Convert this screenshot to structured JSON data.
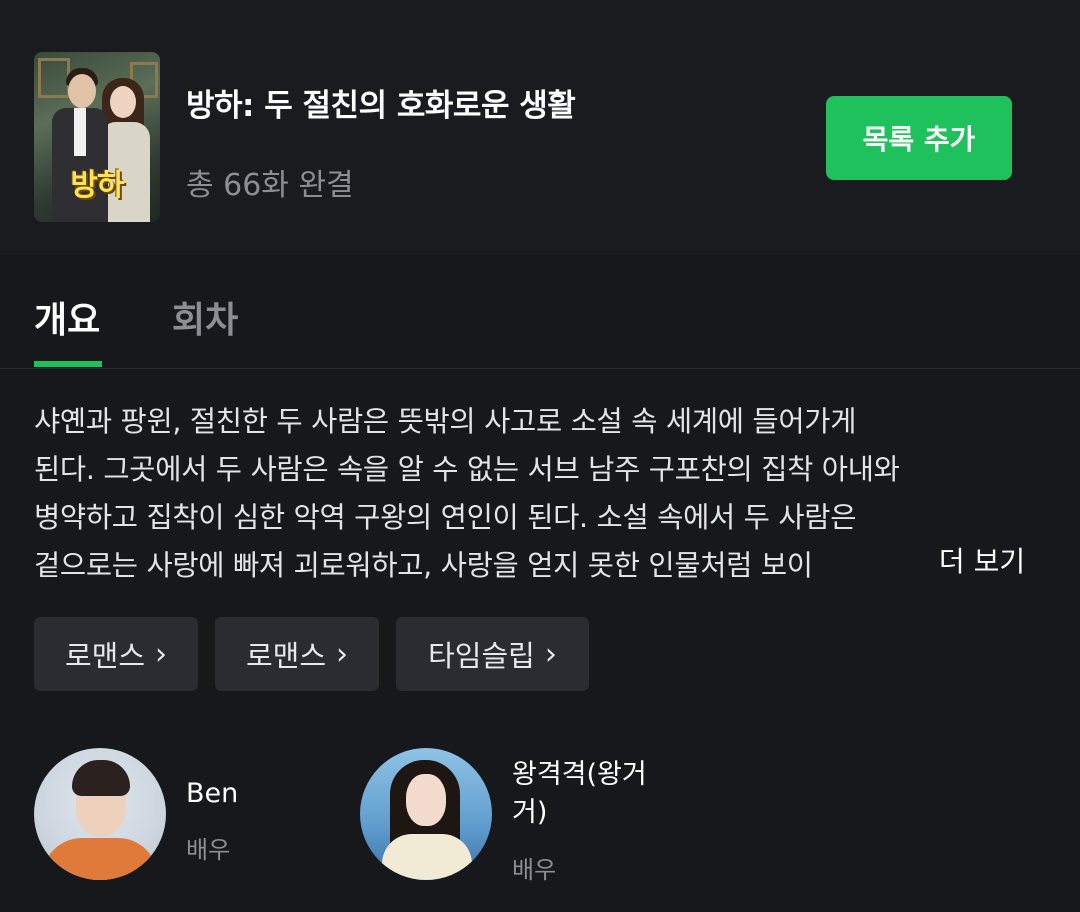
{
  "header": {
    "poster_title": "방하",
    "title": "방하: 두 절친의 호화로운 생활",
    "episodes": "총 66화 완결",
    "add_button": "목록 추가"
  },
  "tabs": [
    {
      "label": "개요",
      "active": true
    },
    {
      "label": "회차",
      "active": false
    }
  ],
  "synopsis": {
    "lines": [
      "샤옌과 팡윈, 절친한 두 사람은 뜻밖의 사고로 소설 속 세계에 들어가게",
      "된다. 그곳에서 두 사람은 속을 알 수 없는 서브 남주 구포찬의 집착 아내와",
      "병약하고 집착이 심한 악역 구왕의 연인이 된다. 소설 속에서 두 사람은",
      "겉으로는 사랑에 빠져 괴로워하고, 사랑을 얻지 못한 인물처럼 보이"
    ],
    "more": "더 보기"
  },
  "tags": [
    {
      "label": "로맨스",
      "chevron": "›"
    },
    {
      "label": "로맨스",
      "chevron": "›"
    },
    {
      "label": "타임슬립",
      "chevron": "›"
    }
  ],
  "cast": [
    {
      "name": "Ben",
      "role": "배우"
    },
    {
      "name": "왕격격(왕거거)",
      "role": "배우"
    }
  ],
  "colors": {
    "background": "#17181c",
    "accent_green": "#1fc15d",
    "muted_text": "#8d8e93",
    "tag_bg": "#2b2c31"
  }
}
